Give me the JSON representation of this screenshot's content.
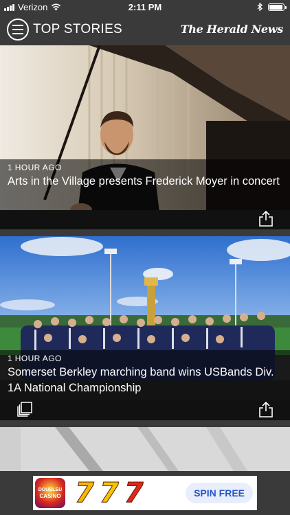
{
  "status_bar": {
    "carrier": "Verizon",
    "time": "2:11 PM",
    "battery_level": 0.95
  },
  "navbar": {
    "title": "TOP STORIES",
    "masthead": "The Herald News",
    "menu_icon": "hamburger-menu-icon"
  },
  "stories": [
    {
      "time": "1 HOUR AGO",
      "headline": "Arts in the Village presents Frederick Moyer in concert",
      "image": "pianist-at-grand-piano",
      "actions": [
        "share-icon"
      ]
    },
    {
      "time": "1 HOUR AGO",
      "headline": "Somerset Berkley marching band wins USBands Div. 1A National Championship",
      "image": "marching-band-group-photo",
      "actions": [
        "gallery-icon",
        "share-icon"
      ]
    },
    {
      "image": "grayscale-texture-photo"
    }
  ],
  "ad": {
    "logo_line1": "DOUBLEU",
    "logo_line2": "CASINO",
    "slots": [
      "7",
      "7",
      "7"
    ],
    "cta": "SPIN FREE",
    "slot_colors": [
      "#f5b800",
      "#f5c400",
      "#e3261b"
    ]
  }
}
